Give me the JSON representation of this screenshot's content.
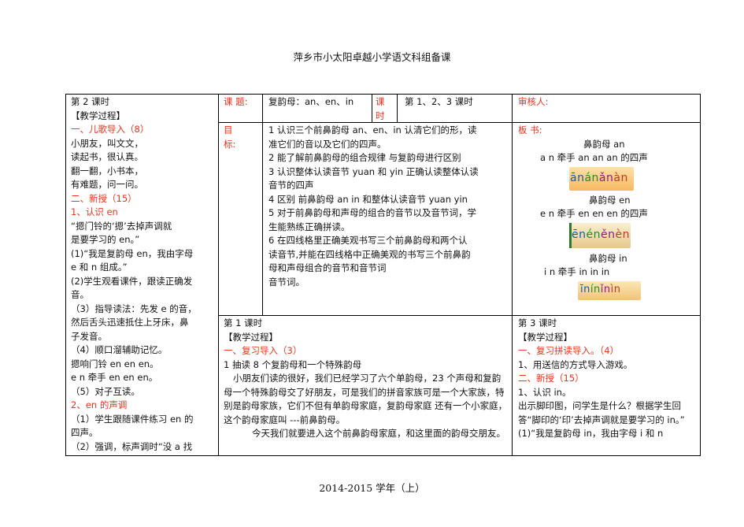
{
  "header": {
    "title": "萍乡市小太阳卓越小学语文科组备课"
  },
  "footer": {
    "year": "2014-2015 学年（上）"
  },
  "left_col": {
    "lines": [
      {
        "text": "第 2 课时",
        "red": false
      },
      {
        "text": "【教学过程】",
        "red": false
      },
      {
        "text": "一、儿歌导入（8）",
        "red": true
      },
      {
        "text": "小朋友，叫文文，",
        "red": false
      },
      {
        "text": "读起书，很认真。",
        "red": false
      },
      {
        "text": "翻一翻，小书本，",
        "red": false
      },
      {
        "text": "有难题，问一问。",
        "red": false
      },
      {
        "text": "二、新授（15）",
        "red": true
      },
      {
        "text": "1、认识 en",
        "red": true
      },
      {
        "text": "“摁门铃的‘摁’去掉声调就",
        "red": false
      },
      {
        "text": "是要学习的 en。”",
        "red": false
      },
      {
        "text": "(1)“我是复韵母 en，我由字母",
        "red": false
      },
      {
        "text": "e 和 n 组成。”",
        "red": false
      },
      {
        "text": "(2)学生观看课件，跟读正确发",
        "red": false
      },
      {
        "text": "音。",
        "red": false
      },
      {
        "text": "（3）指导读法：先发 e 的音，",
        "red": false
      },
      {
        "text": "然后舌头迅速抵住上牙床，鼻",
        "red": false
      },
      {
        "text": "子发音。",
        "red": false
      },
      {
        "text": "（4）顺口溜辅助记忆。",
        "red": false
      },
      {
        "text": "摁响门铃 en en en。",
        "red": false
      },
      {
        "text": "e n 牵手 en en en。",
        "red": false
      },
      {
        "text": "（5）对子互读。",
        "red": false
      },
      {
        "text": "2、en 的声调",
        "red": true
      },
      {
        "text": "（1）学生跟随课件练习  en 的",
        "red": false
      },
      {
        "text": "四声。",
        "red": false
      },
      {
        "text": "（2）强调，标声调时“没 a 找",
        "red": false
      }
    ]
  },
  "topic_row": {
    "topic_label": "课  题:",
    "topic_value": "复韵母：an、en、in",
    "period_label_1": "课",
    "period_label_2": "时",
    "period_value": "第 1、2、3 课时",
    "reviewer_label": "审核人:"
  },
  "goals": {
    "label_1": "目",
    "label_2": "标:",
    "lines": [
      "1 认识三个前鼻韵母 an、en、in 认清它们的形，读",
      "准它们的音以及它们的四声。",
      "2 能了解前鼻韵母的组合规律 与复韵母进行区别",
      "3 认识整体认读音节 yuan 和 yin 正确认读整体认读",
      "音节的四声",
      "4 区别 前鼻韵母 an in 和整体认读音节 yuan yin",
      "5 对于前鼻韵母和声母的组合的音节以及音节词，学",
      "生能熟练正确拼读。",
      "6 在四线格里正确美观书写三个前鼻韵母和两个认",
      "读音节,并能在四线格中正确美观的书写三个前鼻韵",
      "母和声母组合的音节和音节词",
      "音节词。"
    ]
  },
  "board": {
    "label": "板    书:",
    "an_title": "鼻韵母 an",
    "an_line": "a n 牵手 an   an  an 的四声",
    "an_tones": [
      "ān",
      "án",
      "ǎn",
      "àn"
    ],
    "en_title": "鼻韵母 en",
    "en_line": "e n 牵手 en en en 的四声",
    "en_tones": [
      "ēn",
      "én",
      "ěn",
      "èn"
    ],
    "in_title": "鼻韵母 in",
    "in_line": "i  n 牵手  in  in  in",
    "in_tones": [
      "īn",
      "ín",
      "ǐn",
      "ìn"
    ]
  },
  "lesson1": {
    "lines": [
      {
        "text": "第 1 课时",
        "red": false
      },
      {
        "text": "【教学过程】",
        "red": false
      },
      {
        "text": "一、复习导入（3）",
        "red": true
      },
      {
        "text": "1 抽读 8 个复韵母和一个特殊韵母",
        "red": false
      }
    ],
    "para1": "小朋友们读的很好，我们已经学习了六个单韵母，23 个声母和复韵母一个特殊韵母交了好朋友，可是我们的拼音家族可是一个大家族，特别是韵母家族，它们不但有单韵母家庭，复韵母家庭   还有一个小家庭，这个韵母家庭叫 ---前鼻韵母。",
    "para2": "今天我们就要进入这个前鼻韵母家庭，和这里面的韵母交朋友。"
  },
  "lesson3": {
    "lines": [
      {
        "text": "第 3 课时",
        "red": false
      },
      {
        "text": "【教学过程】",
        "red": false
      },
      {
        "text": "一、复习拼读导入。（4）",
        "red": true
      },
      {
        "text": "1、用送信的方式导入游戏。",
        "red": false
      },
      {
        "text": "二、新授（15）",
        "red": true
      },
      {
        "text": "1、认识 in。",
        "red": false
      }
    ],
    "para": "出示脚印图，问学生是什么？根据学生回答“脚印的‘印’去掉声调就是要学习的 in。”",
    "last": "(1)“我是复韵母 in，我由字母 i 和 n"
  }
}
